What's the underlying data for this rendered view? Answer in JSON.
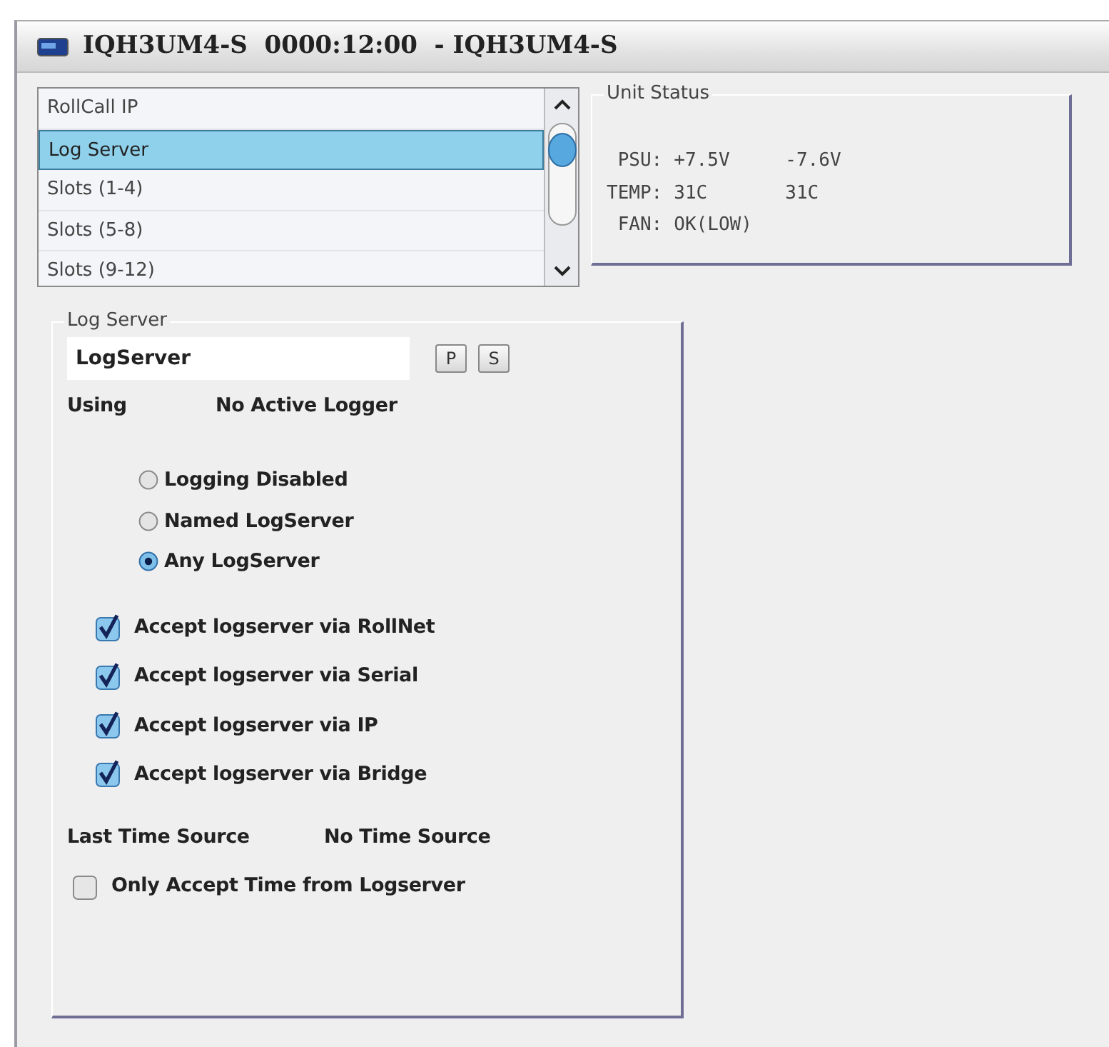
{
  "window": {
    "title": "IQH3UM4-S  0000:12:00  - IQH3UM4-S"
  },
  "nav_list": {
    "items": [
      {
        "label": "RollCall IP",
        "selected": false
      },
      {
        "label": "Log Server",
        "selected": true
      },
      {
        "label": "Slots (1-4)",
        "selected": false
      },
      {
        "label": "Slots (5-8)",
        "selected": false
      },
      {
        "label": "Slots (9-12)",
        "selected": false
      }
    ]
  },
  "unit_status": {
    "title": "Unit Status",
    "rows": [
      {
        "label": "PSU:",
        "values": [
          "+7.5V",
          "-7.6V"
        ]
      },
      {
        "label": "TEMP:",
        "values": [
          "31C",
          "31C"
        ]
      },
      {
        "label": "FAN:",
        "values": [
          "OK(LOW)"
        ]
      }
    ]
  },
  "log_server": {
    "title": "Log Server",
    "name_field": {
      "value": "LogServer"
    },
    "buttons": [
      "P",
      "S"
    ],
    "using": {
      "label": "Using",
      "value": "No Active Logger"
    },
    "radios": [
      {
        "label": "Logging Disabled",
        "selected": false
      },
      {
        "label": "Named LogServer",
        "selected": false
      },
      {
        "label": "Any LogServer",
        "selected": true
      }
    ],
    "checkboxes": [
      {
        "label": "Accept logserver via RollNet",
        "checked": true
      },
      {
        "label": "Accept logserver via Serial",
        "checked": true
      },
      {
        "label": "Accept logserver via IP",
        "checked": true
      },
      {
        "label": "Accept logserver via Bridge",
        "checked": true
      }
    ],
    "last_time_source": {
      "label": "Last Time Source",
      "value": "No Time Source"
    },
    "time_checkbox": {
      "label": "Only Accept Time from Logserver",
      "checked": false
    }
  }
}
